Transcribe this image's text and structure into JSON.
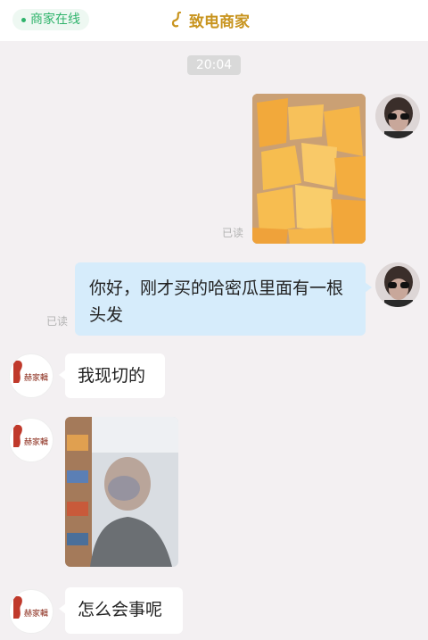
{
  "header": {
    "status_label": "商家在线",
    "call_label": "致电商家",
    "accent": "#c8941e",
    "status_color": "#2fb36b"
  },
  "conversation": {
    "timestamp": "20:04",
    "messages": [
      {
        "from": "user",
        "type": "image",
        "image_desc": "melon-pieces-photo",
        "read_label": "已读"
      },
      {
        "from": "user",
        "type": "text",
        "text": "你好，刚才买的哈密瓜里面有一根头发",
        "read_label": "已读"
      },
      {
        "from": "merchant",
        "type": "text",
        "text": "我现切的"
      },
      {
        "from": "merchant",
        "type": "image",
        "image_desc": "blurred-person-photo"
      },
      {
        "from": "merchant",
        "type": "text",
        "text": "怎么会事呢"
      }
    ]
  },
  "merchant_logo_text": "赫家輯"
}
